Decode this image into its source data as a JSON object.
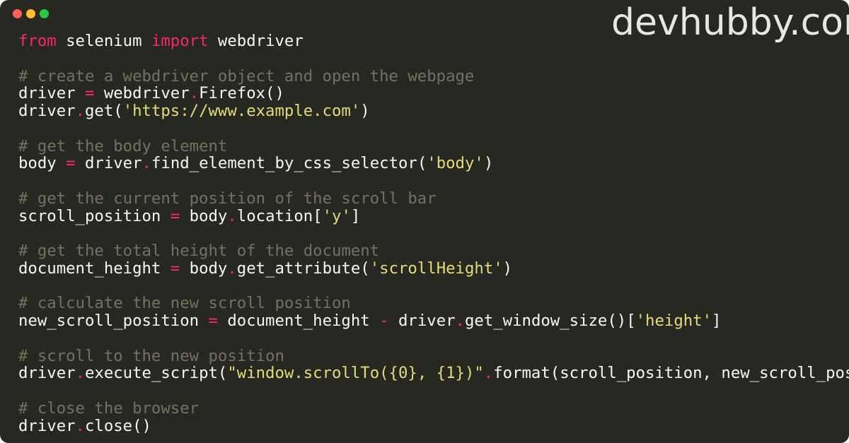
{
  "window": {
    "controls": [
      {
        "name": "close-button",
        "color": "#ff5f57"
      },
      {
        "name": "minimize-button",
        "color": "#febc2e"
      },
      {
        "name": "zoom-button",
        "color": "#28c840"
      }
    ],
    "background": "#272822"
  },
  "watermark": {
    "text": "devhubby.com",
    "color": "#e6e6e6"
  },
  "colors": {
    "plain": "#f8f8f2",
    "keyword": "#f92672",
    "comment": "#75715e",
    "string": "#e6db74"
  },
  "code": {
    "lines": [
      [
        {
          "t": "kw",
          "v": "from"
        },
        {
          "t": "pl",
          "v": " selenium "
        },
        {
          "t": "kw",
          "v": "import"
        },
        {
          "t": "pl",
          "v": " webdriver"
        }
      ],
      [],
      [
        {
          "t": "cm",
          "v": "# create a webdriver object and open the webpage"
        }
      ],
      [
        {
          "t": "pl",
          "v": "driver "
        },
        {
          "t": "kw",
          "v": "="
        },
        {
          "t": "pl",
          "v": " webdriver"
        },
        {
          "t": "kw",
          "v": "."
        },
        {
          "t": "pl",
          "v": "Firefox()"
        }
      ],
      [
        {
          "t": "pl",
          "v": "driver"
        },
        {
          "t": "kw",
          "v": "."
        },
        {
          "t": "pl",
          "v": "get("
        },
        {
          "t": "st",
          "v": "'https://www.example.com'"
        },
        {
          "t": "pl",
          "v": ")"
        }
      ],
      [],
      [
        {
          "t": "cm",
          "v": "# get the body element"
        }
      ],
      [
        {
          "t": "pl",
          "v": "body "
        },
        {
          "t": "kw",
          "v": "="
        },
        {
          "t": "pl",
          "v": " driver"
        },
        {
          "t": "kw",
          "v": "."
        },
        {
          "t": "pl",
          "v": "find_element_by_css_selector("
        },
        {
          "t": "st",
          "v": "'body'"
        },
        {
          "t": "pl",
          "v": ")"
        }
      ],
      [],
      [
        {
          "t": "cm",
          "v": "# get the current position of the scroll bar"
        }
      ],
      [
        {
          "t": "pl",
          "v": "scroll_position "
        },
        {
          "t": "kw",
          "v": "="
        },
        {
          "t": "pl",
          "v": " body"
        },
        {
          "t": "kw",
          "v": "."
        },
        {
          "t": "pl",
          "v": "location["
        },
        {
          "t": "st",
          "v": "'y'"
        },
        {
          "t": "pl",
          "v": "]"
        }
      ],
      [],
      [
        {
          "t": "cm",
          "v": "# get the total height of the document"
        }
      ],
      [
        {
          "t": "pl",
          "v": "document_height "
        },
        {
          "t": "kw",
          "v": "="
        },
        {
          "t": "pl",
          "v": " body"
        },
        {
          "t": "kw",
          "v": "."
        },
        {
          "t": "pl",
          "v": "get_attribute("
        },
        {
          "t": "st",
          "v": "'scrollHeight'"
        },
        {
          "t": "pl",
          "v": ")"
        }
      ],
      [],
      [
        {
          "t": "cm",
          "v": "# calculate the new scroll position"
        }
      ],
      [
        {
          "t": "pl",
          "v": "new_scroll_position "
        },
        {
          "t": "kw",
          "v": "="
        },
        {
          "t": "pl",
          "v": " document_height "
        },
        {
          "t": "kw",
          "v": "-"
        },
        {
          "t": "pl",
          "v": " driver"
        },
        {
          "t": "kw",
          "v": "."
        },
        {
          "t": "pl",
          "v": "get_window_size()["
        },
        {
          "t": "st",
          "v": "'height'"
        },
        {
          "t": "pl",
          "v": "]"
        }
      ],
      [],
      [
        {
          "t": "cm",
          "v": "# scroll to the new position"
        }
      ],
      [
        {
          "t": "pl",
          "v": "driver"
        },
        {
          "t": "kw",
          "v": "."
        },
        {
          "t": "pl",
          "v": "execute_script("
        },
        {
          "t": "st",
          "v": "\"window.scrollTo({0}, {1})\""
        },
        {
          "t": "kw",
          "v": "."
        },
        {
          "t": "pl",
          "v": "format(scroll_position, new_scroll_posit"
        }
      ],
      [],
      [
        {
          "t": "cm",
          "v": "# close the browser"
        }
      ],
      [
        {
          "t": "pl",
          "v": "driver"
        },
        {
          "t": "kw",
          "v": "."
        },
        {
          "t": "pl",
          "v": "close()"
        }
      ]
    ]
  }
}
